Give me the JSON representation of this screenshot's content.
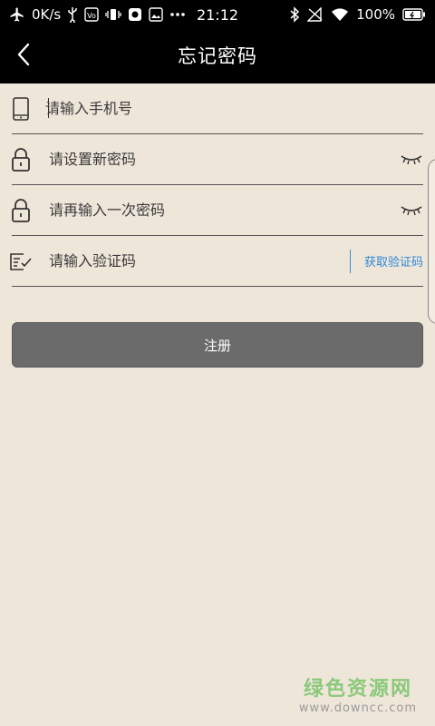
{
  "statusbar": {
    "speed": "0K/s",
    "time": "21:12",
    "battery": "100%",
    "icons": [
      "airplane-icon",
      "usb-icon",
      "vo-icon",
      "vibrate-icon",
      "app-icon",
      "image-icon",
      "more-dots-icon",
      "bluetooth-icon",
      "signal-off-icon",
      "wifi-icon",
      "battery-icon"
    ]
  },
  "header": {
    "title": "忘记密码",
    "back_icon": "back-arrow-icon"
  },
  "form": {
    "phone": {
      "placeholder": "请输入手机号",
      "value": "",
      "icon": "phone-icon"
    },
    "new_password": {
      "placeholder": "请设置新密码",
      "value": "",
      "icon": "lock-icon",
      "toggle_icon": "eye-closed-icon"
    },
    "confirm_password": {
      "placeholder": "请再输入一次密码",
      "value": "",
      "icon": "lock-icon",
      "toggle_icon": "eye-closed-icon"
    },
    "verify_code": {
      "placeholder": "请输入验证码",
      "value": "",
      "icon": "verify-icon",
      "button_label": "获取验证码"
    }
  },
  "submit": {
    "label": "注册"
  },
  "watermark": {
    "main": "绿色资源网",
    "url": "www.downcc.com"
  },
  "colors": {
    "background": "#efe6da",
    "bar": "#000000",
    "button": "#6b6b6b",
    "link": "#2f8ad6"
  }
}
